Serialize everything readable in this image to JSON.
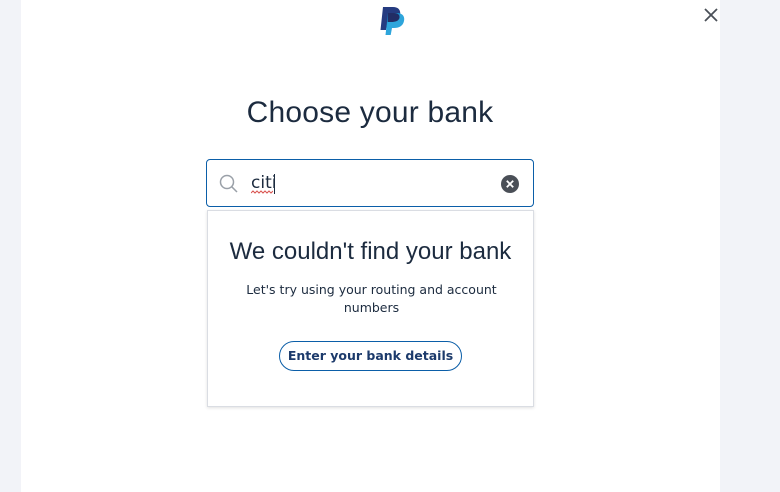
{
  "header": {
    "logo_icon": "paypal-logo-icon",
    "close_icon": "close-icon"
  },
  "title": "Choose your bank",
  "search": {
    "icon": "search-icon",
    "value": "citi",
    "clear_icon": "clear-circle-icon"
  },
  "results": {
    "title": "We couldn't find your bank",
    "message": "Let's try using your routing and account numbers",
    "button_label": "Enter your bank details"
  },
  "colors": {
    "accent": "#0b5ea8",
    "text": "#1c2b3f",
    "page_bg": "#f2f3f8"
  }
}
